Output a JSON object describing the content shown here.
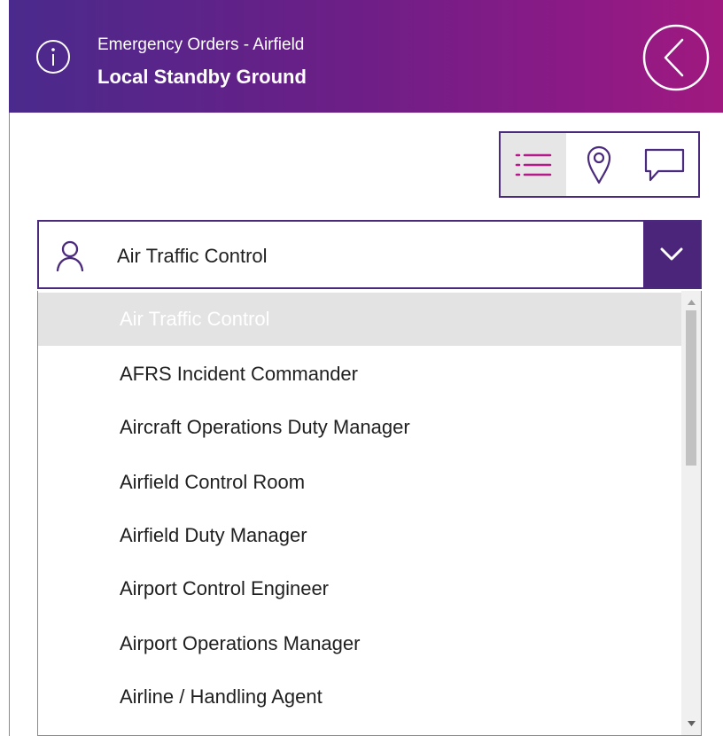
{
  "header": {
    "title": "Emergency Orders - Airfield",
    "subtitle": "Local Standby Ground",
    "info_icon": "info-circle-icon",
    "back_icon": "chevron-left-circle-icon"
  },
  "view_toolbar": {
    "buttons": [
      {
        "icon": "list-icon",
        "active": true
      },
      {
        "icon": "map-pin-icon",
        "active": false
      },
      {
        "icon": "chat-bubble-icon",
        "active": false
      }
    ]
  },
  "role_dropdown": {
    "icon": "person-icon",
    "selected": "Air Traffic Control",
    "chevron_icon": "chevron-down-icon"
  },
  "role_list": {
    "items": [
      "Air Traffic Control",
      "AFRS Incident Commander",
      "Aircraft Operations Duty Manager",
      "Airfield Control Room",
      "Airfield Duty Manager",
      "Airport Control Engineer",
      "Airport Operations Manager",
      "Airline / Handling Agent"
    ],
    "selected_index": 0
  },
  "colors": {
    "header_start": "#4a2a8c",
    "header_end": "#a0197f",
    "accent": "#b5198a",
    "border": "#4a2a7c",
    "chevron_bg": "#4a2579"
  }
}
